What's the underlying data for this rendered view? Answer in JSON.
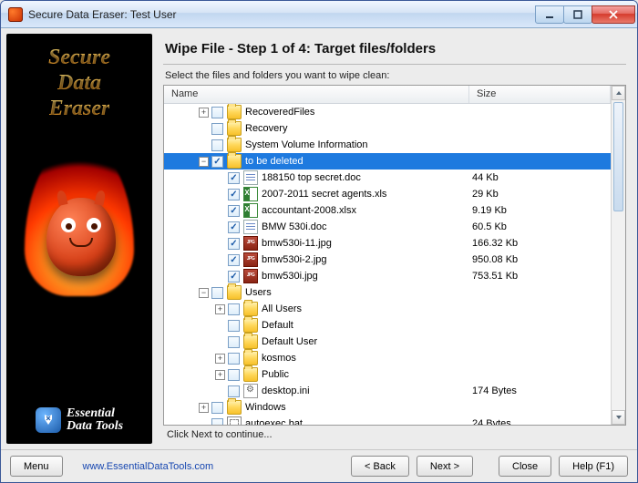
{
  "window": {
    "title": "Secure Data Eraser: Test User"
  },
  "sidebar": {
    "logo_line1": "Secure",
    "logo_line2": "Data",
    "logo_line3": "Eraser",
    "brand_line1": "Essential",
    "brand_line2": "Data Tools"
  },
  "main": {
    "step_title": "Wipe File - Step 1 of 4: Target files/folders",
    "instruction": "Select the files and folders you want to wipe clean:",
    "columns": {
      "name": "Name",
      "size": "Size"
    },
    "hint": "Click Next to continue..."
  },
  "tree": [
    {
      "indent": 1,
      "exp": "+",
      "chk": false,
      "icon": "folder",
      "label": "RecoveredFiles",
      "size": "",
      "selected": false
    },
    {
      "indent": 1,
      "exp": "",
      "chk": false,
      "icon": "folder",
      "label": "Recovery",
      "size": "",
      "selected": false
    },
    {
      "indent": 1,
      "exp": "",
      "chk": false,
      "icon": "folder",
      "label": "System Volume Information",
      "size": "",
      "selected": false
    },
    {
      "indent": 1,
      "exp": "-",
      "chk": true,
      "icon": "folder",
      "label": "to be deleted",
      "size": "",
      "selected": true
    },
    {
      "indent": 2,
      "exp": "",
      "chk": true,
      "icon": "doc",
      "label": "188150 top secret.doc",
      "size": "44 Kb",
      "selected": false
    },
    {
      "indent": 2,
      "exp": "",
      "chk": true,
      "icon": "xls",
      "label": "2007-2011 secret agents.xls",
      "size": "29 Kb",
      "selected": false
    },
    {
      "indent": 2,
      "exp": "",
      "chk": true,
      "icon": "xls",
      "label": "accountant-2008.xlsx",
      "size": "9.19 Kb",
      "selected": false
    },
    {
      "indent": 2,
      "exp": "",
      "chk": true,
      "icon": "doc",
      "label": "BMW 530i.doc",
      "size": "60.5 Kb",
      "selected": false
    },
    {
      "indent": 2,
      "exp": "",
      "chk": true,
      "icon": "jpg",
      "label": "bmw530i-11.jpg",
      "size": "166.32 Kb",
      "selected": false
    },
    {
      "indent": 2,
      "exp": "",
      "chk": true,
      "icon": "jpg",
      "label": "bmw530i-2.jpg",
      "size": "950.08 Kb",
      "selected": false
    },
    {
      "indent": 2,
      "exp": "",
      "chk": true,
      "icon": "jpg",
      "label": "bmw530i.jpg",
      "size": "753.51 Kb",
      "selected": false
    },
    {
      "indent": 1,
      "exp": "-",
      "chk": false,
      "icon": "folder",
      "label": "Users",
      "size": "",
      "selected": false
    },
    {
      "indent": 2,
      "exp": "+",
      "chk": false,
      "icon": "folder",
      "label": "All Users",
      "size": "",
      "selected": false
    },
    {
      "indent": 2,
      "exp": "",
      "chk": false,
      "icon": "folder",
      "label": "Default",
      "size": "",
      "selected": false
    },
    {
      "indent": 2,
      "exp": "",
      "chk": false,
      "icon": "folder",
      "label": "Default User",
      "size": "",
      "selected": false
    },
    {
      "indent": 2,
      "exp": "+",
      "chk": false,
      "icon": "folder",
      "label": "kosmos",
      "size": "",
      "selected": false
    },
    {
      "indent": 2,
      "exp": "+",
      "chk": false,
      "icon": "folder",
      "label": "Public",
      "size": "",
      "selected": false
    },
    {
      "indent": 2,
      "exp": "",
      "chk": false,
      "icon": "ini",
      "label": "desktop.ini",
      "size": "174 Bytes",
      "selected": false
    },
    {
      "indent": 1,
      "exp": "+",
      "chk": false,
      "icon": "folder",
      "label": "Windows",
      "size": "",
      "selected": false
    },
    {
      "indent": 1,
      "exp": "",
      "chk": false,
      "icon": "bat",
      "label": "autoexec.bat",
      "size": "24 Bytes",
      "selected": false
    }
  ],
  "footer": {
    "menu": "Menu",
    "link": "www.EssentialDataTools.com",
    "back": "< Back",
    "next": "Next >",
    "close": "Close",
    "help": "Help (F1)"
  }
}
